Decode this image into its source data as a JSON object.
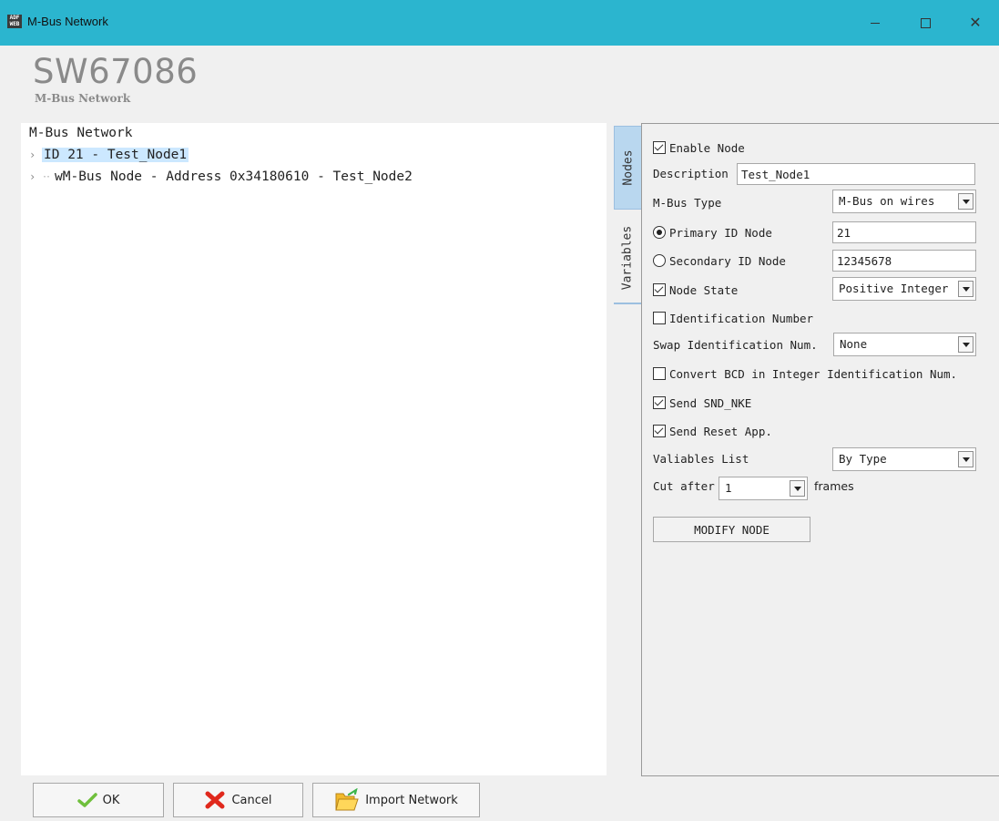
{
  "window": {
    "title": "M-Bus Network",
    "icon_text": "ADF WEB",
    "minimize": "—",
    "close": "✕"
  },
  "brand": {
    "title": "SW67086",
    "subtitle": "M-Bus Network"
  },
  "tree": {
    "root": "M-Bus Network",
    "items": [
      {
        "label": "ID 21 - Test_Node1",
        "selected": true
      },
      {
        "label": "wM-Bus Node - Address 0x34180610 - Test_Node2",
        "selected": false
      }
    ]
  },
  "tabs": {
    "nodes": "Nodes",
    "variables": "Variables"
  },
  "form": {
    "enable_node": {
      "label": "Enable Node",
      "checked": true
    },
    "description": {
      "label": "Description",
      "value": "Test_Node1"
    },
    "mbus_type": {
      "label": "M-Bus Type",
      "value": "M-Bus on wires"
    },
    "primary_id": {
      "label": "Primary ID Node",
      "value": "21",
      "selected": true
    },
    "secondary_id": {
      "label": "Secondary ID Node",
      "value": "12345678",
      "selected": false
    },
    "node_state": {
      "label": "Node State",
      "checked": true,
      "value": "Positive Integer"
    },
    "identification_number": {
      "label": "Identification Number",
      "checked": false
    },
    "swap_identification": {
      "label": "Swap Identification Num.",
      "value": "None"
    },
    "convert_bcd": {
      "label": "Convert BCD in Integer Identification Num.",
      "checked": false
    },
    "send_snd_nke": {
      "label": "Send SND_NKE",
      "checked": true
    },
    "send_reset_app": {
      "label": "Send Reset App.",
      "checked": true
    },
    "variables_list": {
      "label": "Valiables List",
      "value": "By Type"
    },
    "cut_after": {
      "label": "Cut after",
      "value": "1",
      "suffix": "frames"
    },
    "modify_button": "MODIFY NODE"
  },
  "footer": {
    "ok": "OK",
    "cancel": "Cancel",
    "import": "Import Network"
  },
  "colors": {
    "titlebar": "#2bb5cf",
    "selection": "#cce8ff",
    "tab_active": "#b9d7ef"
  }
}
